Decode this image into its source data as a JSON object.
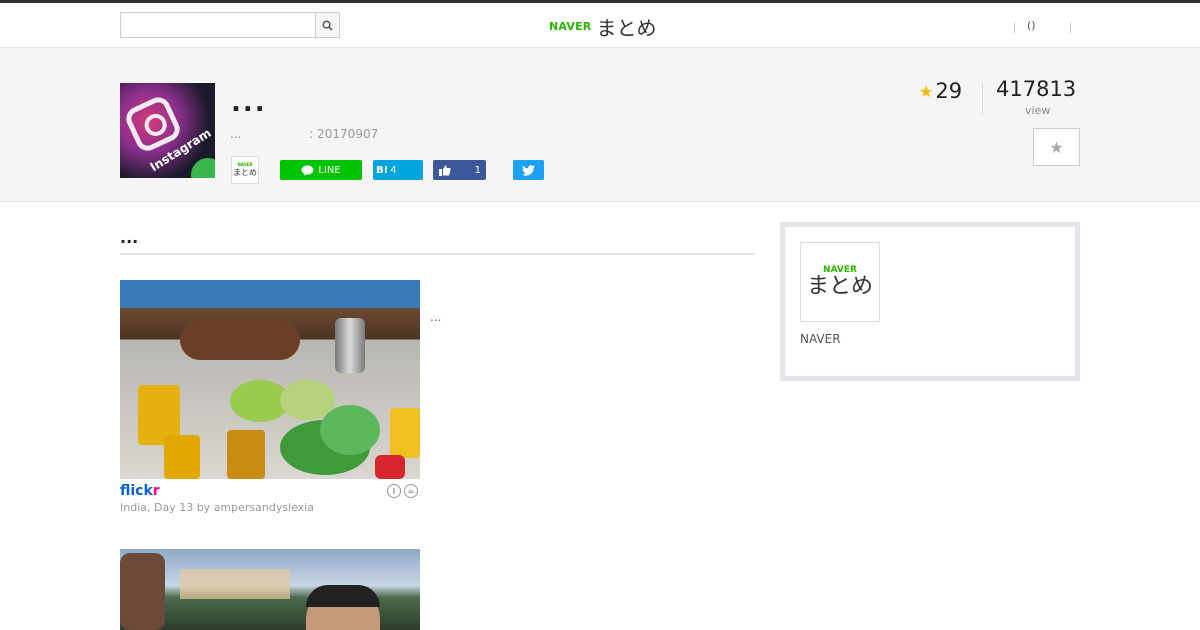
{
  "header": {
    "search": {
      "value": "",
      "placeholder": ""
    },
    "logo": {
      "brand": "NAVER",
      "name": "まとめ"
    },
    "link": "()"
  },
  "summary": {
    "title": "...",
    "meta_author": "...",
    "meta_date": ": 20170907",
    "thumbnail_text": "Instagram",
    "small_logo": {
      "brand": "NAVER",
      "name": "まとめ"
    },
    "share": {
      "line_label": "LINE",
      "hatena_label": "B!",
      "hatena_count": "4",
      "facebook_count": "1"
    },
    "favorites": "29",
    "views": "417813",
    "views_label": "view"
  },
  "main": {
    "section_title": "...",
    "items": [
      {
        "caption": "...",
        "source": {
          "part1": "flick",
          "part2": "r"
        },
        "credit": "India, Day 13 by ampersandyslexia"
      }
    ]
  },
  "sidebar": {
    "logo": {
      "brand": "NAVER",
      "name": "まとめ"
    },
    "name": "NAVER"
  },
  "colors": {
    "naver_green": "#2db400",
    "line_green": "#00c300",
    "hatena_blue": "#00a4de",
    "facebook_blue": "#3b5998",
    "twitter_blue": "#1da1f2",
    "star_yellow": "#f5b800"
  }
}
